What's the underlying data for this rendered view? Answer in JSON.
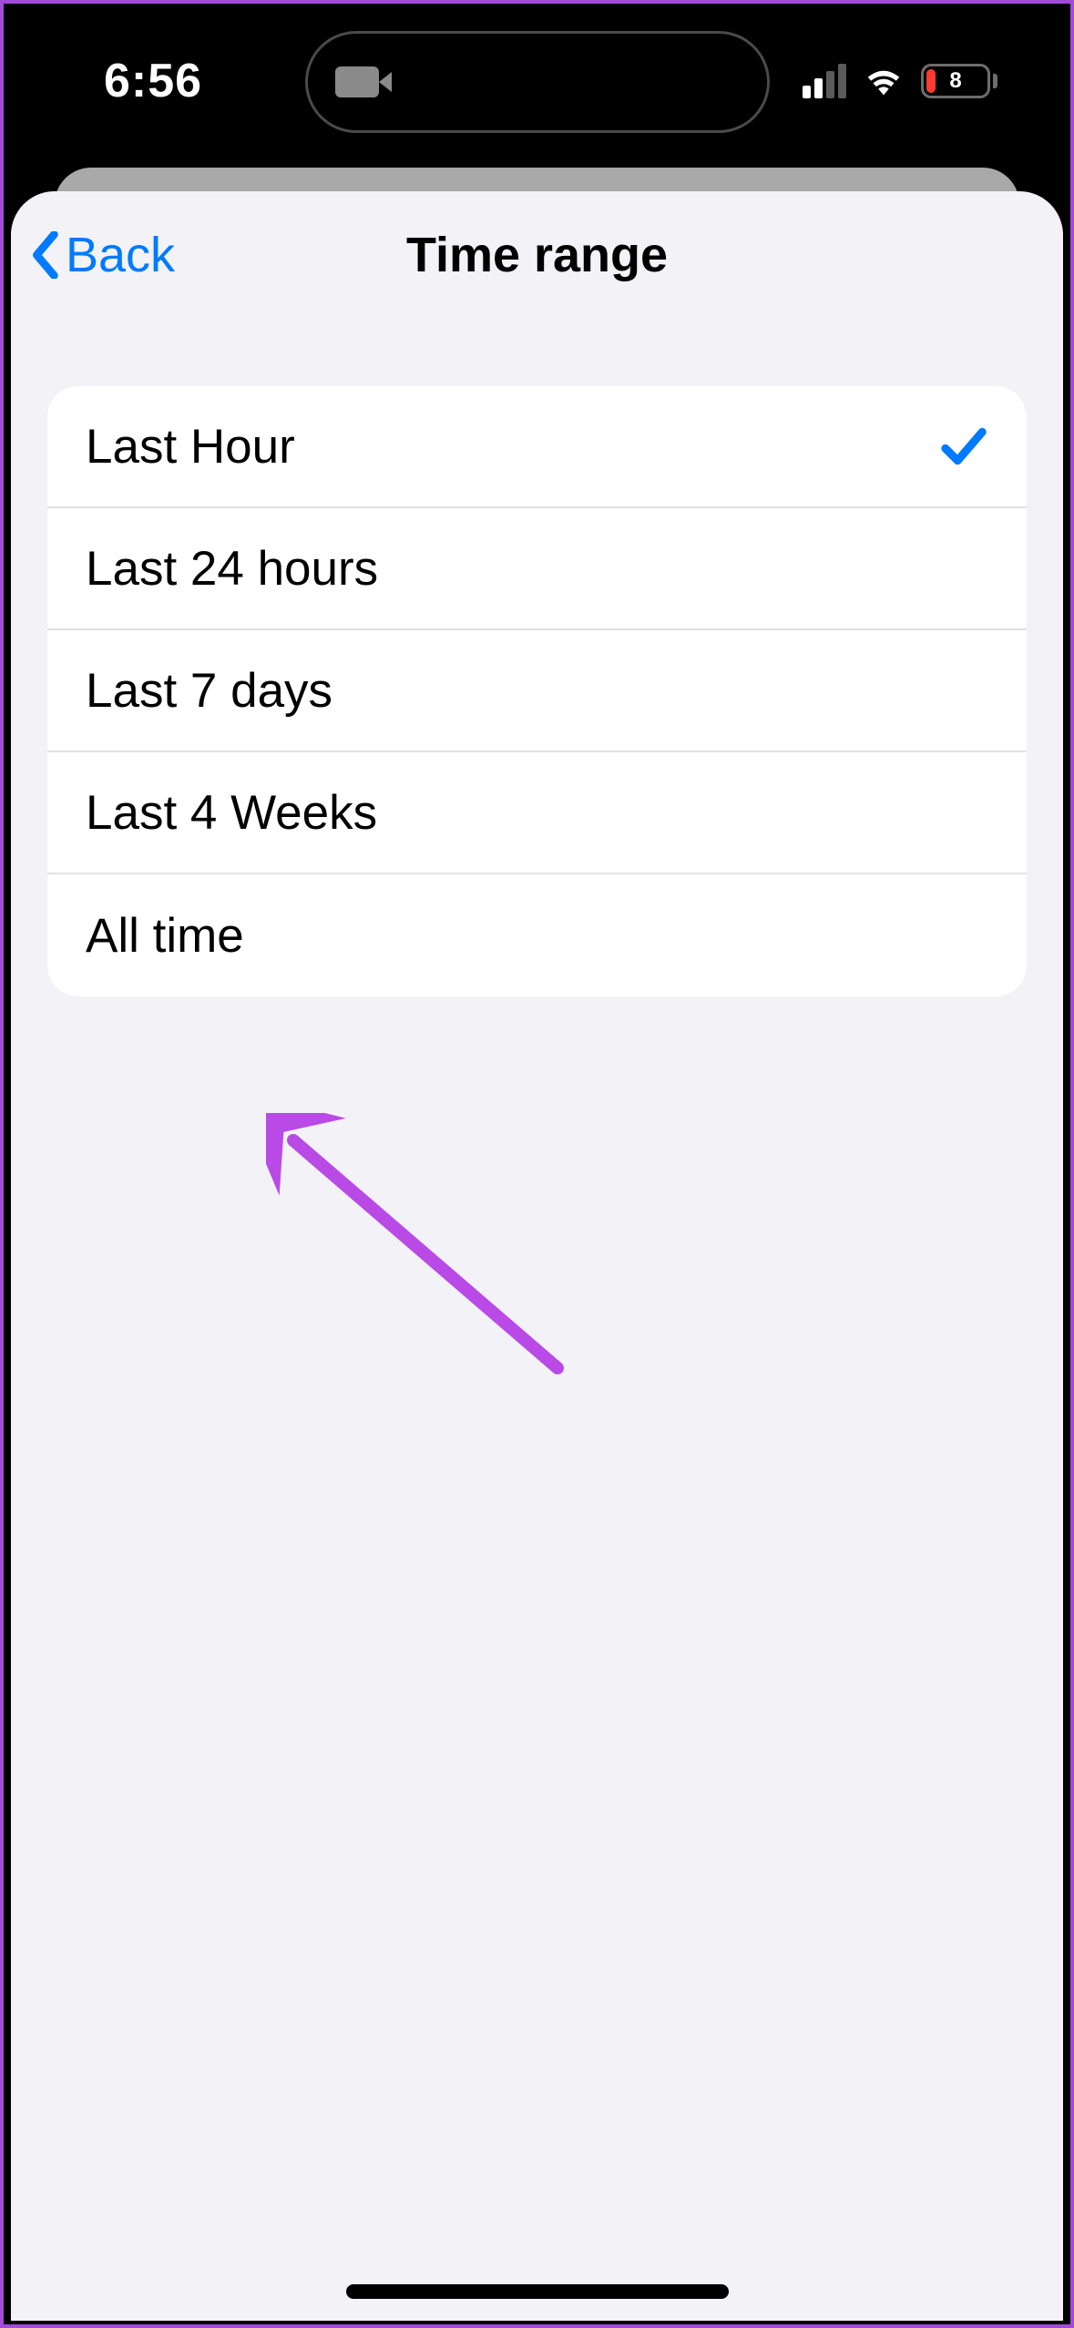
{
  "status": {
    "time": "6:56",
    "battery": "8"
  },
  "nav": {
    "back_label": "Back",
    "title": "Time range"
  },
  "options": [
    {
      "label": "Last Hour",
      "selected": true
    },
    {
      "label": "Last 24 hours",
      "selected": false
    },
    {
      "label": "Last 7 days",
      "selected": false
    },
    {
      "label": "Last 4 Weeks",
      "selected": false
    },
    {
      "label": "All time",
      "selected": false
    }
  ]
}
